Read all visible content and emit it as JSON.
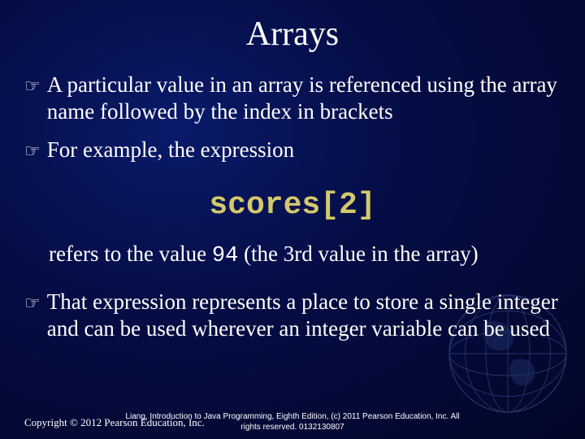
{
  "title": "Arrays",
  "bullets": {
    "b1": "A particular value in an array is referenced using the array name followed by the index in brackets",
    "b2": "For example, the expression",
    "b3": "That expression represents a place to store a single integer and can be used wherever an integer variable can be used"
  },
  "code": "scores[2]",
  "refer": {
    "prefix": "refers to the value ",
    "value": "94",
    "suffix": " (the 3rd value in the array)"
  },
  "footer": {
    "line1": "Liang, Introduction to Java Programming, Eighth Edition, (c) 2011 Pearson Education, Inc. All",
    "line2": "rights reserved. 0132130807",
    "copyright": "Copyright © 2012 Pearson Education, Inc."
  }
}
